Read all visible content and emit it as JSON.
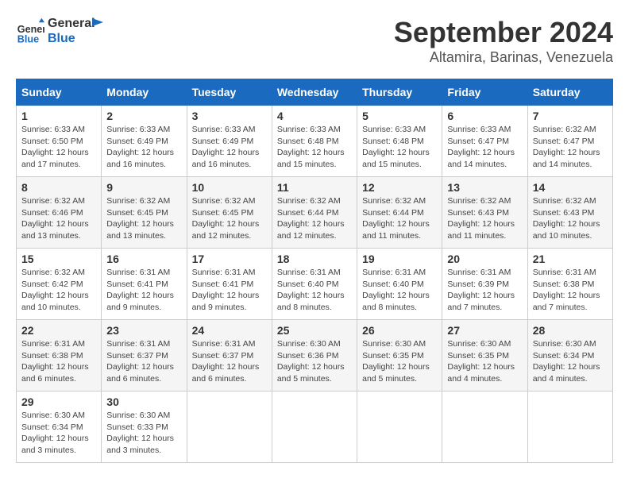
{
  "header": {
    "logo_line1": "General",
    "logo_line2": "Blue",
    "month": "September 2024",
    "location": "Altamira, Barinas, Venezuela"
  },
  "weekdays": [
    "Sunday",
    "Monday",
    "Tuesday",
    "Wednesday",
    "Thursday",
    "Friday",
    "Saturday"
  ],
  "weeks": [
    [
      {
        "day": "1",
        "sunrise": "6:33 AM",
        "sunset": "6:50 PM",
        "daylight": "12 hours and 17 minutes."
      },
      {
        "day": "2",
        "sunrise": "6:33 AM",
        "sunset": "6:49 PM",
        "daylight": "12 hours and 16 minutes."
      },
      {
        "day": "3",
        "sunrise": "6:33 AM",
        "sunset": "6:49 PM",
        "daylight": "12 hours and 16 minutes."
      },
      {
        "day": "4",
        "sunrise": "6:33 AM",
        "sunset": "6:48 PM",
        "daylight": "12 hours and 15 minutes."
      },
      {
        "day": "5",
        "sunrise": "6:33 AM",
        "sunset": "6:48 PM",
        "daylight": "12 hours and 15 minutes."
      },
      {
        "day": "6",
        "sunrise": "6:33 AM",
        "sunset": "6:47 PM",
        "daylight": "12 hours and 14 minutes."
      },
      {
        "day": "7",
        "sunrise": "6:32 AM",
        "sunset": "6:47 PM",
        "daylight": "12 hours and 14 minutes."
      }
    ],
    [
      {
        "day": "8",
        "sunrise": "6:32 AM",
        "sunset": "6:46 PM",
        "daylight": "12 hours and 13 minutes."
      },
      {
        "day": "9",
        "sunrise": "6:32 AM",
        "sunset": "6:45 PM",
        "daylight": "12 hours and 13 minutes."
      },
      {
        "day": "10",
        "sunrise": "6:32 AM",
        "sunset": "6:45 PM",
        "daylight": "12 hours and 12 minutes."
      },
      {
        "day": "11",
        "sunrise": "6:32 AM",
        "sunset": "6:44 PM",
        "daylight": "12 hours and 12 minutes."
      },
      {
        "day": "12",
        "sunrise": "6:32 AM",
        "sunset": "6:44 PM",
        "daylight": "12 hours and 11 minutes."
      },
      {
        "day": "13",
        "sunrise": "6:32 AM",
        "sunset": "6:43 PM",
        "daylight": "12 hours and 11 minutes."
      },
      {
        "day": "14",
        "sunrise": "6:32 AM",
        "sunset": "6:43 PM",
        "daylight": "12 hours and 10 minutes."
      }
    ],
    [
      {
        "day": "15",
        "sunrise": "6:32 AM",
        "sunset": "6:42 PM",
        "daylight": "12 hours and 10 minutes."
      },
      {
        "day": "16",
        "sunrise": "6:31 AM",
        "sunset": "6:41 PM",
        "daylight": "12 hours and 9 minutes."
      },
      {
        "day": "17",
        "sunrise": "6:31 AM",
        "sunset": "6:41 PM",
        "daylight": "12 hours and 9 minutes."
      },
      {
        "day": "18",
        "sunrise": "6:31 AM",
        "sunset": "6:40 PM",
        "daylight": "12 hours and 8 minutes."
      },
      {
        "day": "19",
        "sunrise": "6:31 AM",
        "sunset": "6:40 PM",
        "daylight": "12 hours and 8 minutes."
      },
      {
        "day": "20",
        "sunrise": "6:31 AM",
        "sunset": "6:39 PM",
        "daylight": "12 hours and 7 minutes."
      },
      {
        "day": "21",
        "sunrise": "6:31 AM",
        "sunset": "6:38 PM",
        "daylight": "12 hours and 7 minutes."
      }
    ],
    [
      {
        "day": "22",
        "sunrise": "6:31 AM",
        "sunset": "6:38 PM",
        "daylight": "12 hours and 6 minutes."
      },
      {
        "day": "23",
        "sunrise": "6:31 AM",
        "sunset": "6:37 PM",
        "daylight": "12 hours and 6 minutes."
      },
      {
        "day": "24",
        "sunrise": "6:31 AM",
        "sunset": "6:37 PM",
        "daylight": "12 hours and 6 minutes."
      },
      {
        "day": "25",
        "sunrise": "6:30 AM",
        "sunset": "6:36 PM",
        "daylight": "12 hours and 5 minutes."
      },
      {
        "day": "26",
        "sunrise": "6:30 AM",
        "sunset": "6:35 PM",
        "daylight": "12 hours and 5 minutes."
      },
      {
        "day": "27",
        "sunrise": "6:30 AM",
        "sunset": "6:35 PM",
        "daylight": "12 hours and 4 minutes."
      },
      {
        "day": "28",
        "sunrise": "6:30 AM",
        "sunset": "6:34 PM",
        "daylight": "12 hours and 4 minutes."
      }
    ],
    [
      {
        "day": "29",
        "sunrise": "6:30 AM",
        "sunset": "6:34 PM",
        "daylight": "12 hours and 3 minutes."
      },
      {
        "day": "30",
        "sunrise": "6:30 AM",
        "sunset": "6:33 PM",
        "daylight": "12 hours and 3 minutes."
      },
      null,
      null,
      null,
      null,
      null
    ]
  ],
  "labels": {
    "sunrise_label": "Sunrise:",
    "sunset_label": "Sunset:",
    "daylight_label": "Daylight:"
  }
}
